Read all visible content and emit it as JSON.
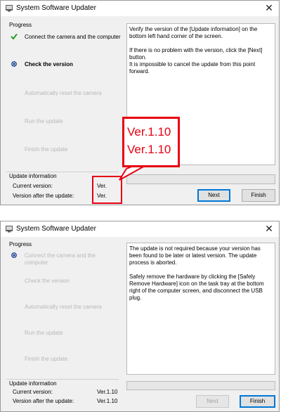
{
  "windows": [
    {
      "title": "System Software Updater",
      "progress_label": "Progress",
      "steps": [
        {
          "label": "Connect the camera and the computer",
          "state": "done",
          "marker": "check-icon"
        },
        {
          "label": "Check the version",
          "state": "current",
          "marker": "bullet-icon"
        },
        {
          "label": "Automatically reset the camera",
          "state": "pending"
        },
        {
          "label": "Run the update",
          "state": "pending"
        },
        {
          "label": "Finish the update",
          "state": "pending"
        }
      ],
      "message": "Verify the version of the [Update information] on the bottom left hand corner of the screen.\n\nIf there is no problem with the version, click the [Next] button.\nIt is impossible to cancel the update from this point forward.",
      "update_info_label": "Update information",
      "current_version_label": "Current version:",
      "current_version_value": "Ver.",
      "after_version_label": "Version after the update:",
      "after_version_value": "Ver.",
      "next_label": "Next",
      "finish_label": "Finish",
      "callout": {
        "line1": "Ver.1.10",
        "line2": "Ver.1.10",
        "color": "#e60012"
      }
    },
    {
      "title": "System Software Updater",
      "progress_label": "Progress",
      "steps": [
        {
          "label": "Connect the camera and the computer",
          "state": "pending",
          "marker": "bullet-icon"
        },
        {
          "label": "Check the version",
          "state": "pending"
        },
        {
          "label": "Automatically reset the camera",
          "state": "pending"
        },
        {
          "label": "Run the update",
          "state": "pending"
        },
        {
          "label": "Finish the update",
          "state": "pending"
        }
      ],
      "message": "The update is not required because your version has been found to be later or latest version. The update process is aborted.\n\nSafely remove the hardware by clicking the [Safely Remove Hardware] icon on the task tray at the bottom right of the computer screen, and disconnect the USB plug.",
      "update_info_label": "Update information",
      "current_version_label": "Current version:",
      "current_version_value": "Ver.1.10",
      "after_version_label": "Version after the update:",
      "after_version_value": "Ver.1.10",
      "next_label": "Next",
      "finish_label": "Finish"
    }
  ],
  "colors": {
    "accent": "#0078d7",
    "check": "#2e9a2e",
    "highlight": "#e60012"
  }
}
